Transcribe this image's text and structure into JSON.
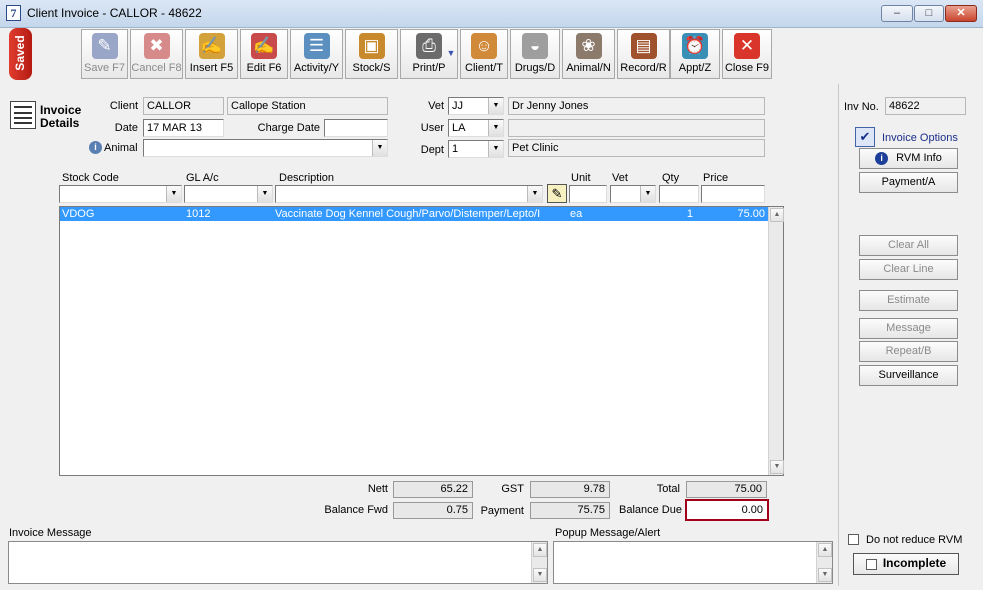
{
  "window": {
    "icon": "7",
    "title": "Client Invoice - CALLOR - 48622",
    "min_glyph": "–",
    "max_glyph": "□",
    "close_glyph": "✕"
  },
  "saved_badge": "Saved",
  "toolbar": [
    {
      "id": "save",
      "label": "Save F7",
      "icon": "pen-icon",
      "disabled": true,
      "color": "#9aa6c8",
      "glyph": "✎"
    },
    {
      "id": "cancel",
      "label": "Cancel F8",
      "icon": "cancel-x-icon",
      "disabled": true,
      "color": "#d78a8a",
      "glyph": "✖"
    },
    {
      "id": "insert",
      "label": "Insert F5",
      "icon": "insert-icon",
      "disabled": false,
      "color": "#d4a23a",
      "glyph": "✍"
    },
    {
      "id": "edit",
      "label": "Edit F6",
      "icon": "edit-icon",
      "disabled": false,
      "color": "#c94a4a",
      "glyph": "✍"
    },
    {
      "id": "activity",
      "label": "Activity/Y",
      "icon": "scroll-icon",
      "disabled": false,
      "color": "#5a8fbf",
      "glyph": "☰"
    },
    {
      "id": "stock",
      "label": "Stock/S",
      "icon": "stock-box-icon",
      "disabled": false,
      "color": "#c98a2e",
      "glyph": "▣"
    },
    {
      "id": "print",
      "label": "Print/P",
      "icon": "printer-icon",
      "disabled": false,
      "color": "#6b6b6b",
      "glyph": "⎙"
    },
    {
      "id": "client",
      "label": "Client/T",
      "icon": "people-icon",
      "disabled": false,
      "color": "#d08a3a",
      "glyph": "☺"
    },
    {
      "id": "drugs",
      "label": "Drugs/D",
      "icon": "pill-icon",
      "disabled": false,
      "color": "#9e9e9e",
      "glyph": "◒"
    },
    {
      "id": "animal",
      "label": "Animal/N",
      "icon": "dog-icon",
      "disabled": false,
      "color": "#8c7a6b",
      "glyph": "❀"
    },
    {
      "id": "record",
      "label": "Record/R",
      "icon": "record-book-icon",
      "disabled": false,
      "color": "#a0522d",
      "glyph": "▤"
    },
    {
      "id": "appt",
      "label": "Appt/Z",
      "icon": "clock-icon",
      "disabled": false,
      "color": "#3a8fb7",
      "glyph": "⏰"
    },
    {
      "id": "close",
      "label": "Close F9",
      "icon": "close-circle-icon",
      "disabled": false,
      "color": "#d9352a",
      "glyph": "✕"
    }
  ],
  "invoice_details": {
    "heading_line1": "Invoice",
    "heading_line2": "Details"
  },
  "form": {
    "client_label": "Client",
    "client_code": "CALLOR",
    "client_name": "Callope Station",
    "date_label": "Date",
    "date": "17 MAR 13",
    "charge_date_label": "Charge Date",
    "charge_date": "",
    "animal_label": "Animal",
    "animal": "",
    "vet_label": "Vet",
    "vet_code": "JJ",
    "vet_name": "Dr Jenny Jones",
    "user_label": "User",
    "user_code": "LA",
    "user_name": "",
    "dept_label": "Dept",
    "dept_code": "1",
    "dept_name": "Pet Clinic",
    "inv_no_label": "Inv No.",
    "inv_no": "48622"
  },
  "line_headers": {
    "stock_code": "Stock Code",
    "gl": "GL A/c",
    "description": "Description",
    "unit": "Unit",
    "vet": "Vet",
    "qty": "Qty",
    "price": "Price"
  },
  "lines": [
    {
      "stock_code": "VDOG",
      "gl": "1012",
      "description": "Vaccinate Dog Kennel Cough/Parvo/Distemper/Lepto/I",
      "unit": "ea",
      "qty": "1",
      "price": "75.00"
    }
  ],
  "totals": {
    "nett_label": "Nett",
    "nett": "65.22",
    "gst_label": "GST",
    "gst": "9.78",
    "total_label": "Total",
    "total": "75.00",
    "balance_fwd_label": "Balance Fwd",
    "balance_fwd": "0.75",
    "payment_label": "Payment",
    "payment": "75.75",
    "balance_due_label": "Balance Due",
    "balance_due": "0.00"
  },
  "side": {
    "invoice_options": "Invoice Options",
    "rvm_info": "RVM Info",
    "payment": "Payment/A",
    "clear_all": "Clear All",
    "clear_line": "Clear Line",
    "estimate": "Estimate",
    "message": "Message",
    "repeat": "Repeat/B",
    "surveillance": "Surveillance",
    "do_not_reduce": "Do not reduce RVM",
    "incomplete": "Incomplete"
  },
  "memos": {
    "invoice_message": "Invoice Message",
    "popup_message": "Popup Message/Alert"
  },
  "colors": {
    "selected_row": "#3399ff",
    "balance_due_border": "#a0001a"
  }
}
